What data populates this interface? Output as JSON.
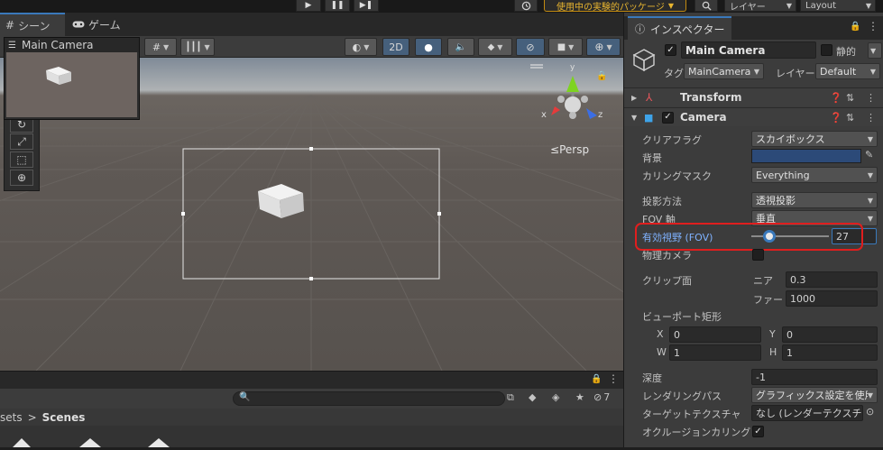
{
  "toolbar": {
    "play_icon": "▶",
    "pause_icon": "❚❚",
    "step_icon": "▶❚",
    "history_icon": "history-icon",
    "package_label": "使用中の実験的パッケージ",
    "layer_label": "レイヤー",
    "layout_label": "Layout"
  },
  "scene": {
    "tabs": [
      {
        "label": "シーン",
        "icon": "grid-icon",
        "active": true
      },
      {
        "label": "ゲーム",
        "icon": "gamepad-icon",
        "active": false
      }
    ],
    "toggle_2d": "2D",
    "camera_preview_title": "Main Camera",
    "persp_label": "Persp",
    "axis_x": "x",
    "axis_y": "y",
    "axis_z": "z"
  },
  "project": {
    "breadcrumb_root": "sets",
    "breadcrumb_sep": ">",
    "breadcrumb_current": "Scenes",
    "hidden_count": "7"
  },
  "inspector": {
    "tab_label": "インスペクター",
    "object_name": "Main Camera",
    "static_label": "静的",
    "tag_label": "タグ",
    "tag_value": "MainCamera",
    "layer_label": "レイヤー",
    "layer_value": "Default",
    "components": {
      "transform": "Transform",
      "camera": "Camera"
    },
    "fields": {
      "clear_flags_label": "クリアフラグ",
      "clear_flags_value": "スカイボックス",
      "background_label": "背景",
      "background_color": "#2c4a78",
      "culling_mask_label": "カリングマスク",
      "culling_mask_value": "Everything",
      "projection_label": "投影方法",
      "projection_value": "透視投影",
      "fov_axis_label": "FOV 軸",
      "fov_axis_value": "垂直",
      "fov_label": "有効視野 (FOV)",
      "fov_value": "27",
      "fov_fraction": 0.14,
      "physical_camera_label": "物理カメラ",
      "clipping_label": "クリップ面",
      "near_label": "ニア",
      "near_value": "0.3",
      "far_label": "ファー",
      "far_value": "1000",
      "viewport_label": "ビューポート矩形",
      "x_label": "X",
      "x_value": "0",
      "y_label": "Y",
      "y_value": "0",
      "w_label": "W",
      "w_value": "1",
      "h_label": "H",
      "h_value": "1",
      "depth_label": "深度",
      "depth_value": "-1",
      "rendering_path_label": "レンダリングパス",
      "rendering_path_value": "グラフィックス設定を使用",
      "target_texture_label": "ターゲットテクスチャ",
      "target_texture_value": "なし (レンダーテクスチャ)",
      "occlusion_label": "オクルージョンカリング"
    },
    "highlight_color": "#e01e1e",
    "accent_color": "#3a79bb"
  }
}
